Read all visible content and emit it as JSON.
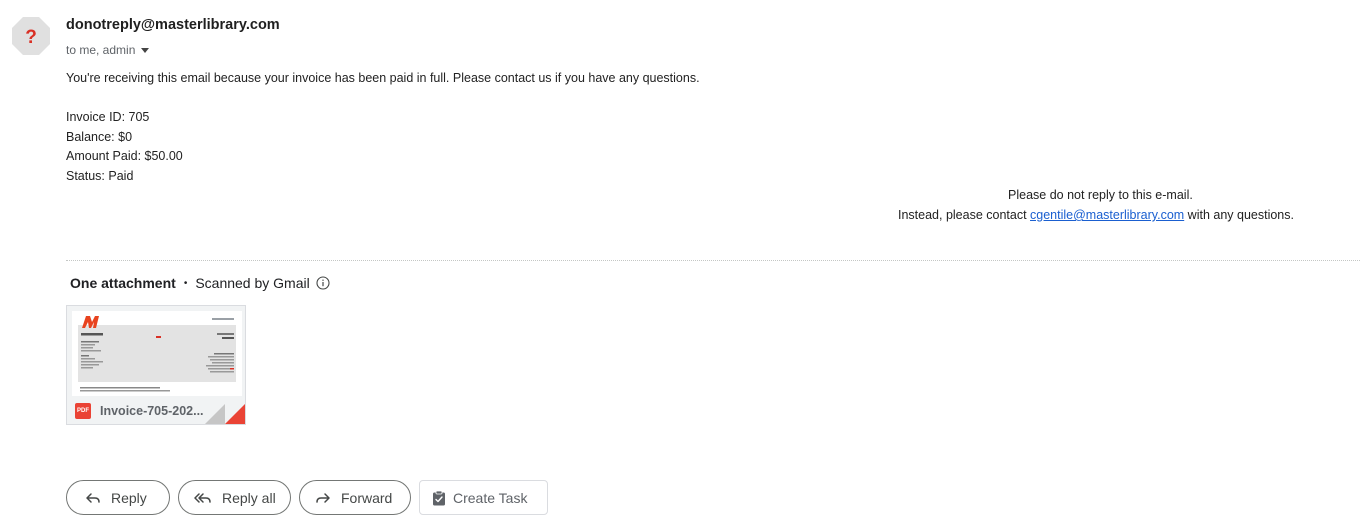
{
  "email": {
    "sender": "donotreply@masterlibrary.com",
    "recipients": "to me, admin",
    "intro": "You're receiving this email because your invoice has been paid in full. Please contact us if you have any questions.",
    "details": [
      "Invoice ID: 705",
      "Balance: $0",
      "Amount Paid: $50.00",
      "Status: Paid"
    ],
    "footer": {
      "line1": "Please do not reply to this e-mail.",
      "line2_prefix": "Instead, please contact ",
      "contact_email": "cgentile@masterlibrary.com",
      "line2_suffix": " with any questions."
    }
  },
  "attachments": {
    "count_label": "One attachment",
    "separator": "•",
    "scan_label": "Scanned by Gmail",
    "items": [
      {
        "file_name": "Invoice-705-202...",
        "type_badge": "PDF",
        "icon": "pdf-icon"
      }
    ]
  },
  "actions": {
    "reply": "Reply",
    "reply_all": "Reply all",
    "forward": "Forward",
    "create_task": "Create Task"
  },
  "colors": {
    "link": "#1a5fd0",
    "pdf_red": "#ea4335",
    "avatar_bg": "#e0e0e0",
    "avatar_mark": "#d93025"
  }
}
